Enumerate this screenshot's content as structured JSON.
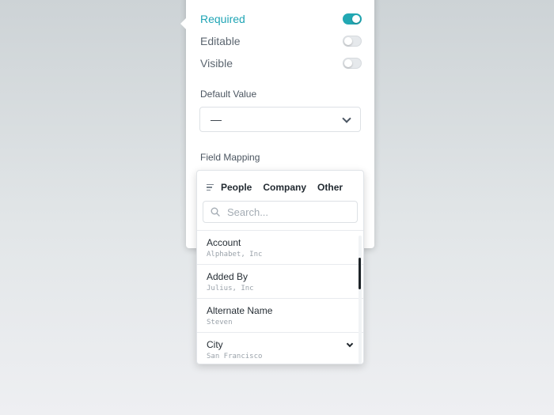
{
  "toggles": [
    {
      "label": "Required",
      "on": true
    },
    {
      "label": "Editable",
      "on": false
    },
    {
      "label": "Visible",
      "on": false
    }
  ],
  "default_value": {
    "label": "Default Value",
    "value": "—",
    "icon": "chevron-down-icon"
  },
  "field_mapping": {
    "label": "Field Mapping",
    "filter_icon": "filter-icon",
    "tabs": [
      {
        "label": "People"
      },
      {
        "label": "Company"
      },
      {
        "label": "Other"
      }
    ],
    "search": {
      "placeholder": "Search...",
      "icon": "search-icon"
    },
    "items": [
      {
        "title": "Account",
        "subtitle": "Alphabet, Inc"
      },
      {
        "title": "Added By",
        "subtitle": "Julius, Inc"
      },
      {
        "title": "Alternate Name",
        "subtitle": "Steven"
      },
      {
        "title": "City",
        "subtitle": "San Francisco"
      }
    ]
  },
  "colors": {
    "accent": "#20a5b5",
    "toggle_on": "#22a8b3",
    "scroll_thumb": "#1e2428"
  }
}
